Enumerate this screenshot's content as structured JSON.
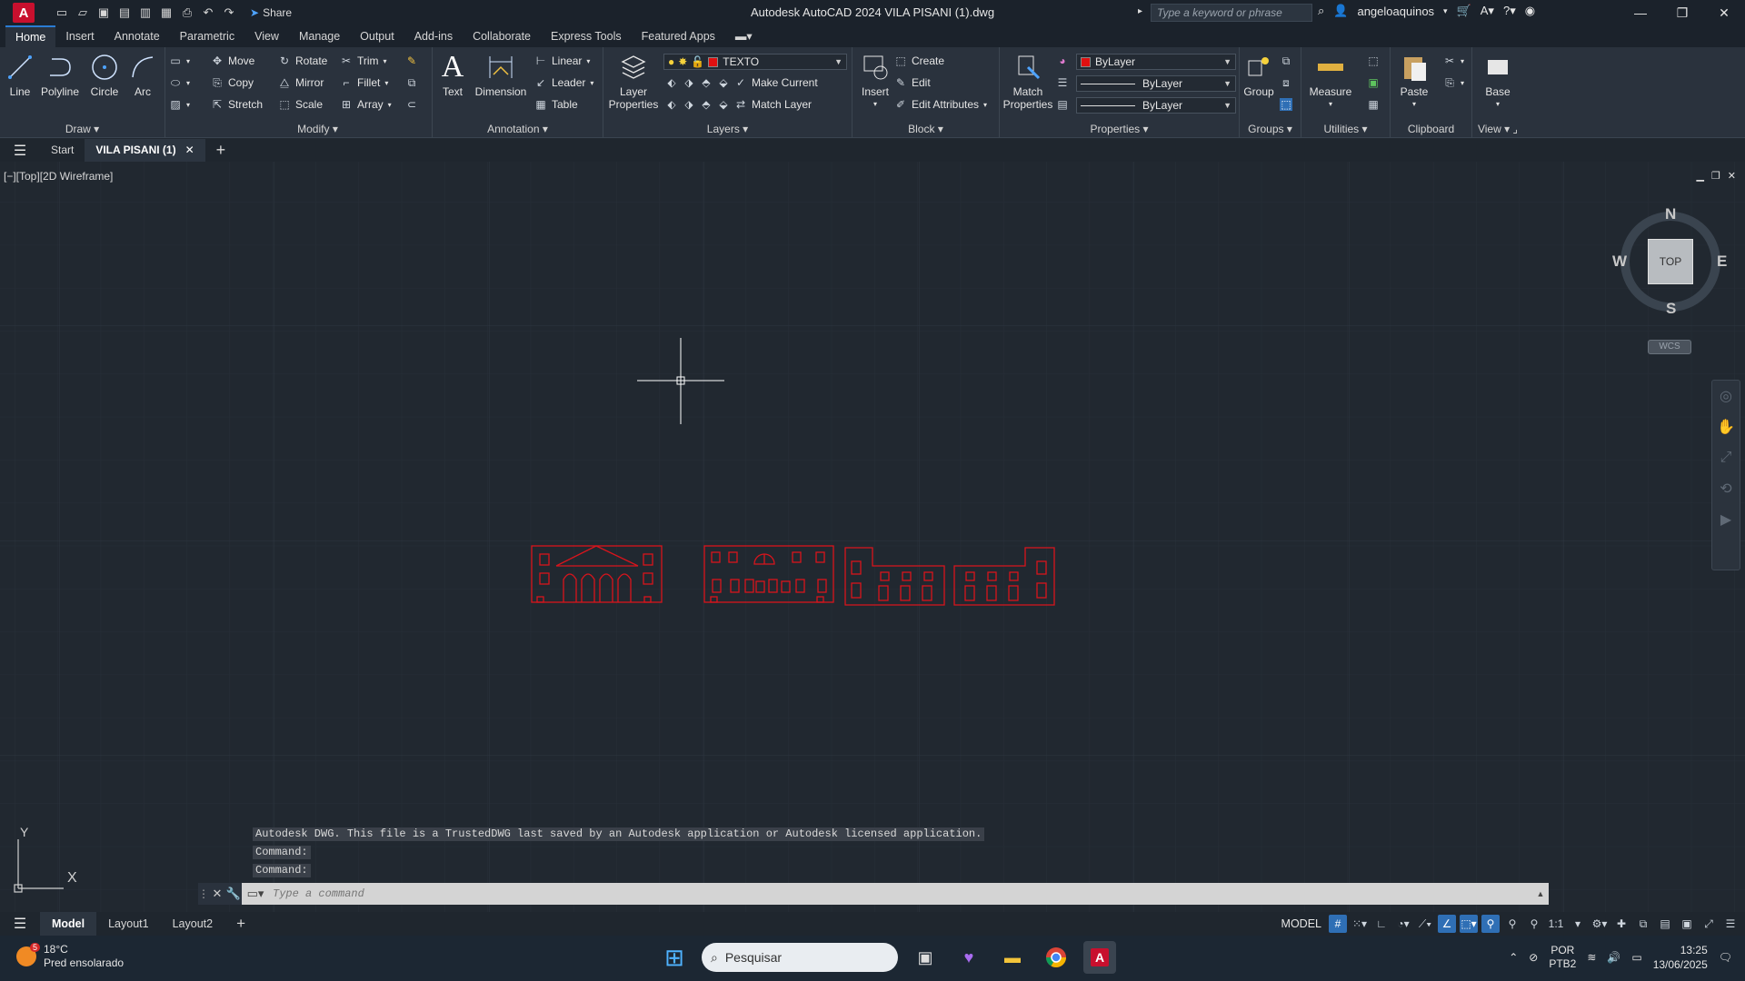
{
  "app": {
    "logo": "A",
    "title": "Autodesk AutoCAD 2024   VILA PISANI (1).dwg",
    "share": "Share",
    "search_placeholder": "Type a keyword or phrase",
    "user": "angeloaquinos"
  },
  "ribbon_tabs": [
    "Home",
    "Insert",
    "Annotate",
    "Parametric",
    "View",
    "Manage",
    "Output",
    "Add-ins",
    "Collaborate",
    "Express Tools",
    "Featured Apps"
  ],
  "draw": {
    "line": "Line",
    "polyline": "Polyline",
    "circle": "Circle",
    "arc": "Arc",
    "title": "Draw"
  },
  "modify": {
    "move": "Move",
    "rotate": "Rotate",
    "trim": "Trim",
    "copy": "Copy",
    "mirror": "Mirror",
    "fillet": "Fillet",
    "stretch": "Stretch",
    "scale": "Scale",
    "array": "Array",
    "title": "Modify"
  },
  "annotation": {
    "text": "Text",
    "dimension": "Dimension",
    "linear": "Linear",
    "leader": "Leader",
    "table": "Table",
    "title": "Annotation"
  },
  "layers": {
    "properties": "Layer Properties",
    "current": "TEXTO",
    "make_current": "Make Current",
    "match_layer": "Match Layer",
    "title": "Layers"
  },
  "block": {
    "insert": "Insert",
    "create": "Create",
    "edit": "Edit",
    "edit_attributes": "Edit Attributes",
    "title": "Block"
  },
  "properties": {
    "match": "Match Properties",
    "color": "ByLayer",
    "linetype": "ByLayer",
    "lineweight": "ByLayer",
    "title": "Properties"
  },
  "groups": {
    "group": "Group",
    "title": "Groups"
  },
  "utilities": {
    "measure": "Measure",
    "title": "Utilities"
  },
  "clipboard": {
    "paste": "Paste",
    "title": "Clipboard"
  },
  "view_panel": {
    "base": "Base",
    "title": "View"
  },
  "filetabs": {
    "start": "Start",
    "doc": "VILA PISANI (1)"
  },
  "viewport": {
    "label": "[−][Top][2D Wireframe]",
    "compass": {
      "n": "N",
      "s": "S",
      "e": "E",
      "w": "W",
      "face": "TOP"
    },
    "wcs": "WCS",
    "ucs_x": "X",
    "ucs_y": "Y"
  },
  "command": {
    "history": [
      "Autodesk DWG.  This file is a TrustedDWG last saved by an Autodesk application or Autodesk licensed application.",
      "Command:",
      "Command:"
    ],
    "placeholder": "Type a command"
  },
  "layout_tabs": [
    "Model",
    "Layout1",
    "Layout2"
  ],
  "status": {
    "model": "MODEL",
    "scale": "1:1"
  },
  "taskbar": {
    "weather_badge": "5",
    "temp": "18°C",
    "weather": "Pred ensolarado",
    "search": "Pesquisar",
    "lang1": "POR",
    "lang2": "PTB2",
    "time": "13:25",
    "date": "13/06/2025"
  },
  "colors": {
    "accent": "#2a7cd3",
    "drawing": "#d9141c",
    "canvas": "#212830"
  }
}
